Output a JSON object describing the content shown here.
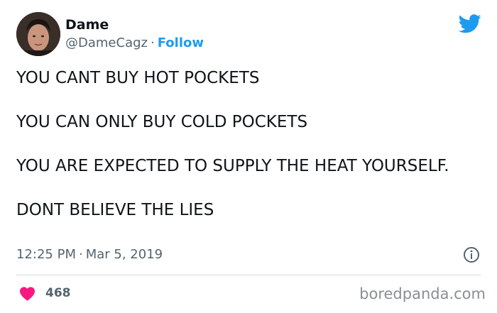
{
  "author": {
    "display_name": "Dame",
    "handle": "@DameCagz",
    "separator": "·",
    "follow_label": "Follow"
  },
  "tweet": {
    "paragraphs": [
      "YOU CANT BUY HOT POCKETS",
      "YOU CAN ONLY BUY COLD POCKETS",
      "YOU ARE EXPECTED TO SUPPLY THE HEAT YOURSELF.",
      "DONT BELIEVE THE LIES"
    ],
    "time": "12:25 PM",
    "separator": "·",
    "date": "Mar 5, 2019",
    "like_count": "468"
  },
  "watermark": "boredpanda.com",
  "icons": {
    "brand": "twitter-bird-icon",
    "info": "info-icon",
    "like": "heart-icon"
  },
  "colors": {
    "twitter_blue": "#1d9bf0",
    "heart_red": "#f91880",
    "secondary_text": "#536471",
    "divider": "#cfd9de"
  }
}
